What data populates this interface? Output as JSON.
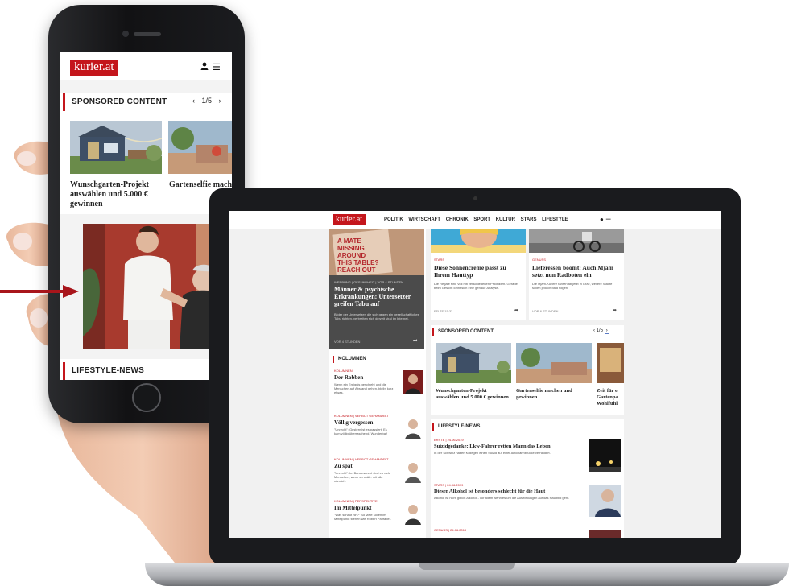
{
  "phone": {
    "logo": "kurier.at",
    "sponsored": {
      "title": "SPONSORED CONTENT",
      "page": "1/5",
      "items": [
        {
          "caption": "Wunschgarten-Projekt auswählen und 5.000 € gewinnen"
        },
        {
          "caption": "Gartenselfie mach gewinnen"
        }
      ]
    },
    "lifestyle_title": "LIFESTYLE-NEWS"
  },
  "laptop": {
    "logo": "kurier.at",
    "nav": [
      "POLITIK",
      "WIRTSCHAFT",
      "CHRONIK",
      "SPORT",
      "KULTUR",
      "STARS",
      "LIFESTYLE"
    ],
    "promo_text": "A MATE MISSING AROUND THIS TABLE? REACH OUT",
    "feature": {
      "kicker": "WERBUNG | GESUNDHEIT | VOR 4 STUNDEN",
      "title": "Männer & psychische Erkrankungen: Untersetzer greifen Tabu auf",
      "teaser": "Bilder der Untersetzer, die sich gegen ein gesellschaftliches Tabu richten, verbreiten sich derzeit viral im Internet.",
      "time": "VOR 4 STUNDEN"
    },
    "card1": {
      "kicker": "STARS",
      "title": "Diese Sonnencreme passt zu Ihrem Hauttyp",
      "teaser": "Die Regale sind voll mit verschiedenen Produkten. Gerade beim Gesicht lohnt sich eine genaue Analyse.",
      "time": "FELTE 15:32"
    },
    "card2": {
      "kicker": "GENUSS",
      "title": "Lieferessen boomt: Auch Mjam setzt nun Radboten ein",
      "teaser": "Die Mjam-Kuriere fahren ab jetzt in Graz, weitere Städte sollen jedoch bald folgen.",
      "time": "VOR 6 STUNDEN"
    },
    "kolumnen_title": "KOLUMNEN",
    "kolumnen": [
      {
        "kicker": "KOLUMNEN",
        "title": "Der Robben",
        "teaser": "Wenn ein Ereignis geschieht und die Menschen auf Abstand gehen, bleibt kurz etwas."
      },
      {
        "kicker": "KOLUMNEN | VERBOT GEHANDELT",
        "title": "Völlig vergessen",
        "teaser": "\"Unrecht\": Gestern ist es passiert. Es kam völlig überraschend. Wunderbar!"
      },
      {
        "kicker": "KOLUMNEN | VERBOT GEHANDELT",
        "title": "Zu spät",
        "teaser": "\"Unrecht\": Im Bundesrecht sind es viele Menschen, wenn zu spät - mit alle nämlich."
      },
      {
        "kicker": "KOLUMNEN | PERSPEKTIVE",
        "title": "Im Mittelpunkt",
        "teaser": "\"Was schaut hin?\" So viele sollen im Mittelpunkt stehen wie Robert Palfrader."
      }
    ],
    "sponsored": {
      "title": "SPONSORED CONTENT",
      "page": "1/5",
      "captions": [
        "Wunschgarten-Projekt auswählen und 5.000 € gewinnen",
        "Gartenselfie machen und gewinnen",
        "Zeit für e Gartenpa Wohlfühl"
      ]
    },
    "lifestyle_title": "LIFESTYLE-NEWS",
    "lifestyle": [
      {
        "kicker": "ERSTE | 24.06.2019",
        "title": "Suizidgedanke: Lkw-Fahrer retten Mann das Leben",
        "teaser": "In der Schweiz haben Kollegen einen Suizid auf einer Autobahnbrücke verhindert."
      },
      {
        "kicker": "STARS | 24.06.2019",
        "title": "Dieser Alkohol ist besonders schlecht für die Haut",
        "teaser": "Alkohol ist nicht gleich Alkohol - vor allem wenn es um die Auswirkungen auf das Hautbild geht."
      },
      {
        "kicker": "GENUSS | 24.06.2019"
      }
    ]
  },
  "colors": {
    "brand_red": "#c4161c",
    "arrow_red": "#a8151b",
    "dark_card": "#4b4b4b"
  }
}
